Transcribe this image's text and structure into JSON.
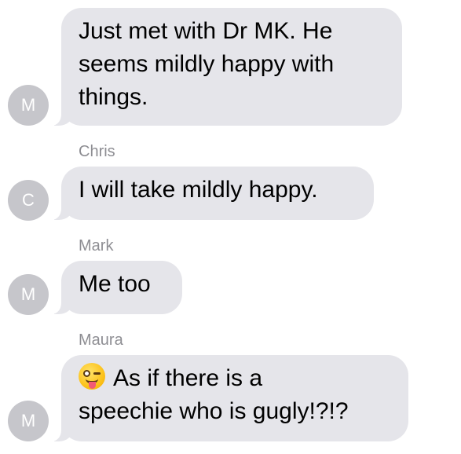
{
  "messages": [
    {
      "sender": "",
      "avatar_initial": "M",
      "text": "Just met with Dr MK. He\nseems mildly happy with\nthings."
    },
    {
      "sender": "Chris",
      "avatar_initial": "C",
      "text": "I will take mildly happy."
    },
    {
      "sender": "Mark",
      "avatar_initial": "M",
      "text": "Me too"
    },
    {
      "sender": "Maura",
      "avatar_initial": "M",
      "emoji": "winking-face-with-tongue",
      "text": "As if there is a\nspeechie who is gugly!?!?"
    }
  ],
  "colors": {
    "bubble": "#e5e5ea",
    "avatar": "#c6c6cb",
    "sender_name": "#8e8e93"
  }
}
